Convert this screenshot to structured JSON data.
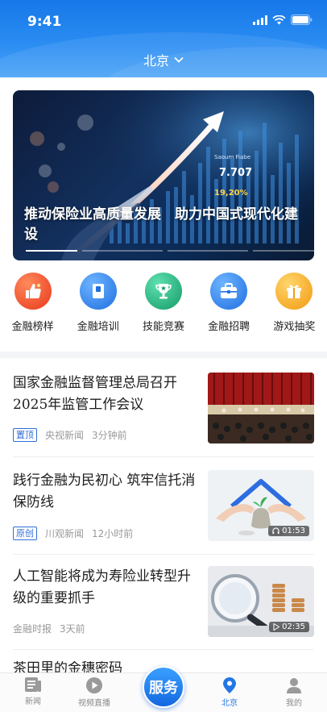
{
  "status_bar": {
    "time": "9:41"
  },
  "header": {
    "location": "北京"
  },
  "banner": {
    "title": "推动保险业高质量发展　助力中国式现代化建设"
  },
  "shortcuts": [
    {
      "label": "金融榜样",
      "icon": "thumbs-up-icon",
      "color": "#f04a2a"
    },
    {
      "label": "金融培训",
      "icon": "book-icon",
      "color": "#2e82ee"
    },
    {
      "label": "技能竞赛",
      "icon": "trophy-icon",
      "color": "#22b07d"
    },
    {
      "label": "金融招聘",
      "icon": "briefcase-icon",
      "color": "#2e82ee"
    },
    {
      "label": "游戏抽奖",
      "icon": "gift-icon",
      "color": "#f5a623"
    }
  ],
  "news": [
    {
      "title": "国家金融监督管理总局召开2025年监管工作会议",
      "tag": "置顶",
      "source": "央视新闻",
      "time": "3分钟前",
      "duration": ""
    },
    {
      "title": "践行金融为民初心 筑牢信托消保防线",
      "tag": "原创",
      "source": "川观新闻",
      "time": "12小时前",
      "duration": "01:53"
    },
    {
      "title": "人工智能将成为寿险业转型升级的重要抓手",
      "tag": "",
      "source": "金融时报",
      "time": "3天前",
      "duration": "02:35"
    },
    {
      "title": "茶田里的金穗密码"
    }
  ],
  "tabbar": {
    "tabs": [
      {
        "label": "新闻",
        "icon": "news-icon"
      },
      {
        "label": "视频直播",
        "icon": "play-icon"
      },
      {
        "label": "北京",
        "icon": "location-pin-icon",
        "active": true
      },
      {
        "label": "我的",
        "icon": "user-icon"
      }
    ],
    "service_label": "服务"
  },
  "colors": {
    "accent": "#2476e6",
    "tag": "#2f6fd6"
  }
}
